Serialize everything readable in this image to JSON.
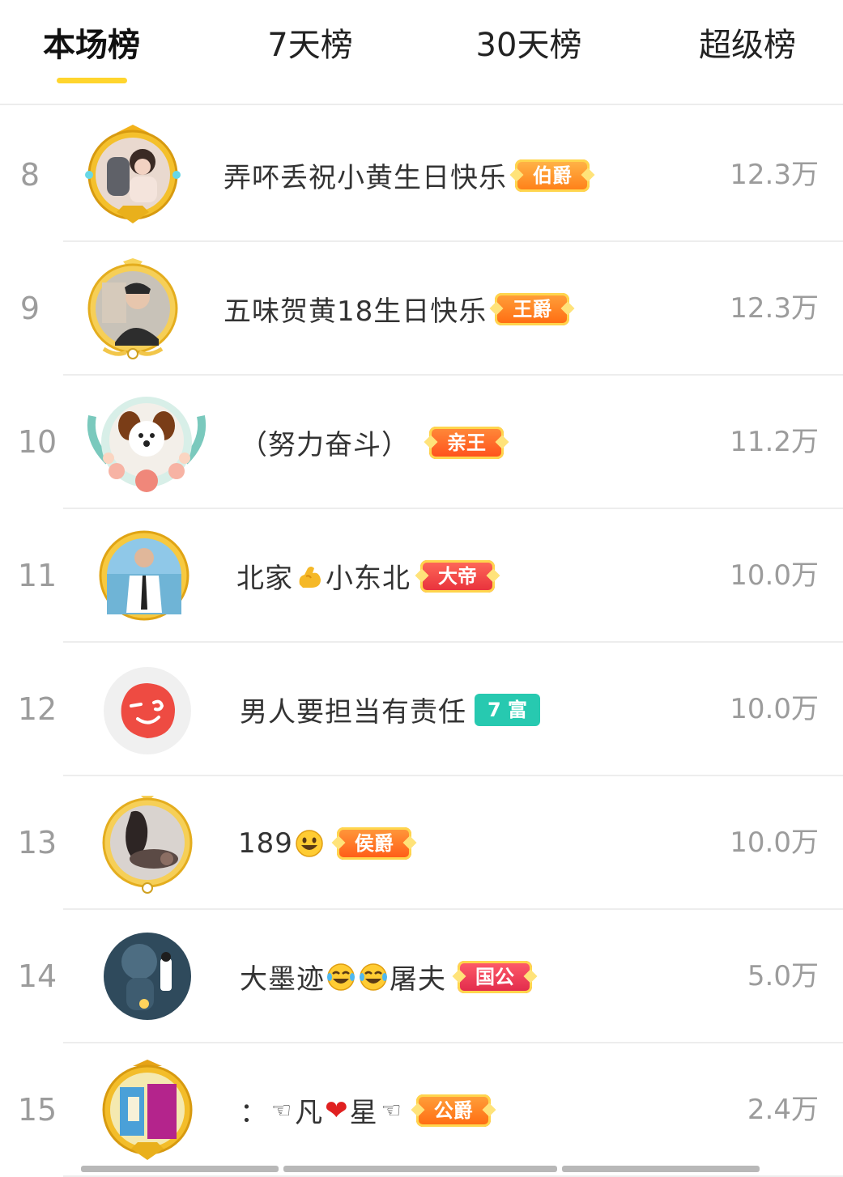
{
  "tabs": [
    {
      "label": "本场榜",
      "active": true
    },
    {
      "label": "7天榜",
      "active": false
    },
    {
      "label": "30天榜",
      "active": false
    },
    {
      "label": "超级榜",
      "active": false
    }
  ],
  "colors": {
    "accent": "#ffd52e",
    "muted_text": "#9c9c9c",
    "divider": "#ededed"
  },
  "rows": [
    {
      "rank": "8",
      "name_parts": [
        "弄吥丢祝小黄生日快乐"
      ],
      "badge": "伯爵",
      "amount": "12.3万"
    },
    {
      "rank": "9",
      "name_parts": [
        "五味贺黄18生日快乐"
      ],
      "badge": "王爵",
      "amount": "12.3万"
    },
    {
      "rank": "10",
      "name_parts": [
        "（努力奋斗）"
      ],
      "badge": "亲王",
      "amount": "11.2万"
    },
    {
      "rank": "11",
      "name_parts": [
        "北家",
        "小东北"
      ],
      "emoji": "flexed-biceps-emoji",
      "badge": "大帝",
      "amount": "10.0万"
    },
    {
      "rank": "12",
      "name_parts": [
        "男人要担当有责任"
      ],
      "badge": "7 富",
      "amount": "10.0万"
    },
    {
      "rank": "13",
      "name_parts": [
        "189"
      ],
      "emoji": "smiley-emoji",
      "badge": "侯爵",
      "amount": "10.0万"
    },
    {
      "rank": "14",
      "name_parts": [
        "大墨迹",
        "屠夫"
      ],
      "emoji": "tears-of-joy-emoji",
      "badge": "国公",
      "amount": "5.0万"
    },
    {
      "rank": "15",
      "name_parts": [
        "：",
        "凡",
        "星"
      ],
      "emoji": "pointing-hand-emoji",
      "badge": "公爵",
      "amount": "2.4万"
    }
  ],
  "name_symbols": {
    "hand": "☜",
    "heart": "❤"
  }
}
